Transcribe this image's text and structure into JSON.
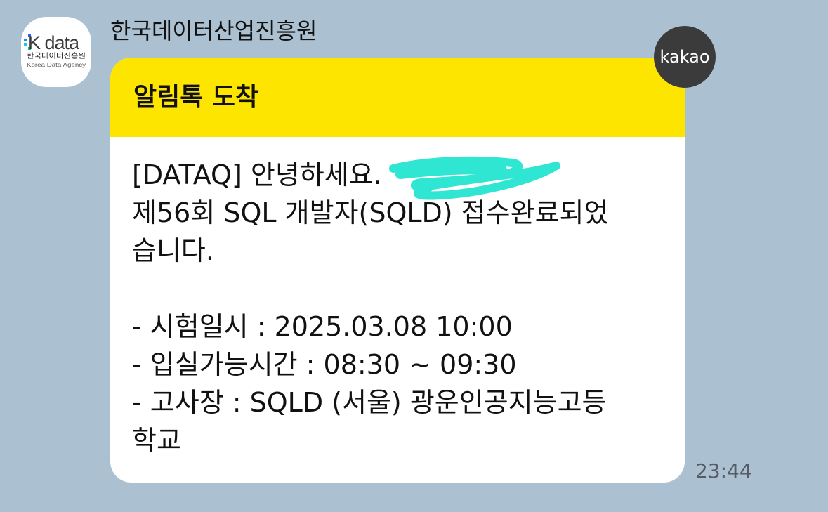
{
  "sender": {
    "name": "한국데이터산업진흥원",
    "avatar": {
      "logo_text": "K data",
      "org_name_ko": "한국데이터진흥원",
      "org_name_en": "Korea Data Agency"
    }
  },
  "message": {
    "title": "알림톡 도착",
    "lines": [
      "[DATAQ] 안녕하세요. ",
      "제56회 SQL 개발자(SQLD) 접수완료되었",
      "습니다.",
      "",
      "- 시험일시 : 2025.03.08 10:00",
      "- 입실가능시간 : 08:30 ~ 09:30",
      "- 고사장 : SQLD (서울) 광운인공지능고등",
      "학교"
    ],
    "badge": "kakao",
    "time": "23:44"
  },
  "colors": {
    "background": "#abc1d1",
    "header": "#fee500",
    "redaction": "#2ee6d2",
    "badge": "#3b3b3b"
  }
}
